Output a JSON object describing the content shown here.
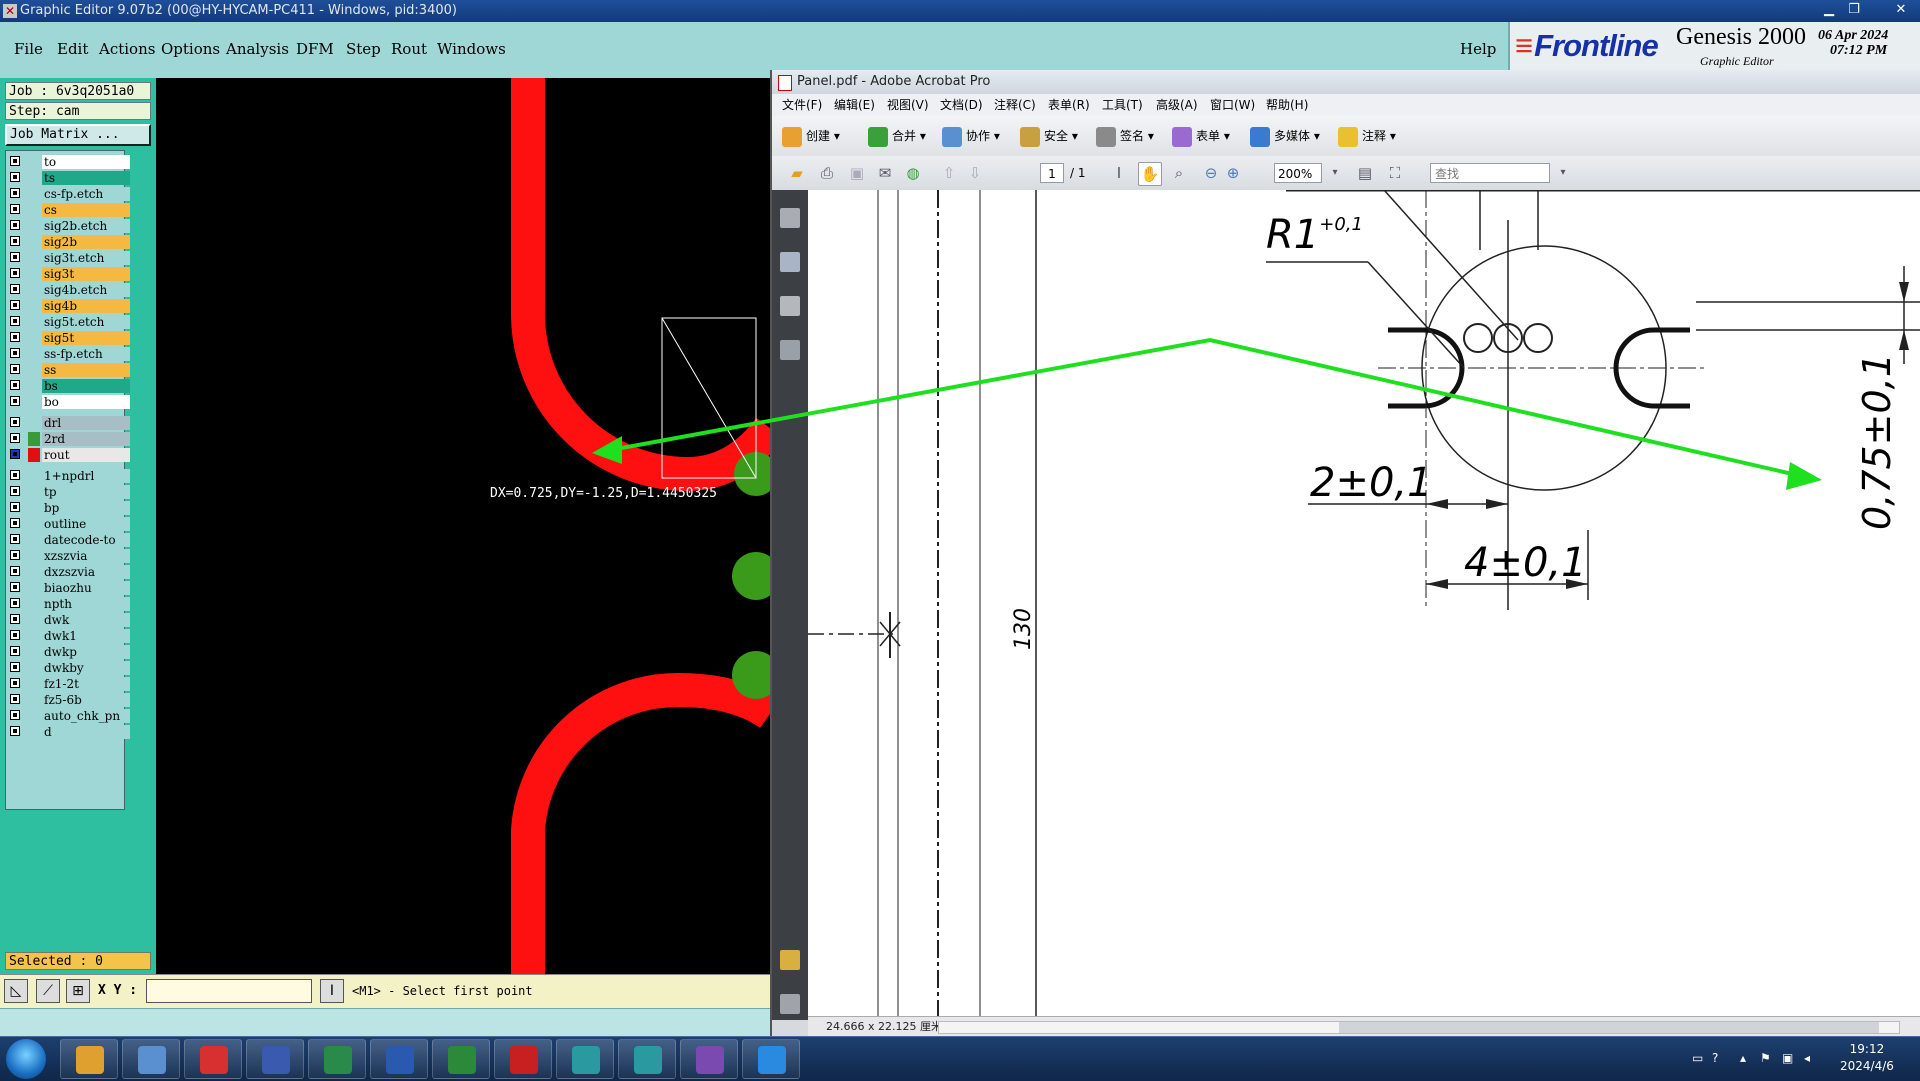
{
  "editor": {
    "title": "Graphic Editor 9.07b2 (00@HY-HYCAM-PC411 - Windows, pid:3400)",
    "menu": [
      "File",
      "Edit",
      "Actions",
      "Options",
      "Analysis",
      "DFM",
      "Step",
      "Rout",
      "Windows"
    ],
    "help": "Help",
    "brand": {
      "logo": "Frontline",
      "product": "Genesis 2000",
      "subtitle": "Graphic Editor",
      "date": "06 Apr 2024",
      "time": "07:12 PM"
    },
    "job": "Job : 6v3q2051a0",
    "step": "Step: cam",
    "job_matrix": "Job Matrix ...",
    "layers": [
      {
        "name": "to",
        "color": "#ffffff"
      },
      {
        "name": "ts",
        "color": "#1fa98a"
      },
      {
        "name": "cs-fp.etch",
        "color": "#9fd6d6"
      },
      {
        "name": "cs",
        "color": "#f4b942"
      },
      {
        "name": "sig2b.etch",
        "color": "#9fd6d6"
      },
      {
        "name": "sig2b",
        "color": "#f4b942"
      },
      {
        "name": "sig3t.etch",
        "color": "#9fd6d6"
      },
      {
        "name": "sig3t",
        "color": "#f4b942"
      },
      {
        "name": "sig4b.etch",
        "color": "#9fd6d6"
      },
      {
        "name": "sig4b",
        "color": "#f4b942"
      },
      {
        "name": "sig5t.etch",
        "color": "#9fd6d6"
      },
      {
        "name": "sig5t",
        "color": "#f4b942"
      },
      {
        "name": "ss-fp.etch",
        "color": "#9fd6d6"
      },
      {
        "name": "ss",
        "color": "#f4b942"
      },
      {
        "name": "bs",
        "color": "#1fa98a"
      },
      {
        "name": "bo",
        "color": "#ffffff"
      },
      {
        "name": "drl",
        "color": "#a7bfc4"
      },
      {
        "name": "2rd",
        "color": "#a7bfc4",
        "swatch": "#3a9a3a"
      },
      {
        "name": "rout",
        "color": "#e8e8e8",
        "swatch": "#e01010",
        "selected": true
      },
      {
        "name": "1+npdrl",
        "color": "#9fd6d6"
      },
      {
        "name": "tp",
        "color": "#9fd6d6"
      },
      {
        "name": "bp",
        "color": "#9fd6d6"
      },
      {
        "name": "outline",
        "color": "#9fd6d6"
      },
      {
        "name": "datecode-to",
        "color": "#9fd6d6"
      },
      {
        "name": "xzszvia",
        "color": "#9fd6d6"
      },
      {
        "name": "dxzszvia",
        "color": "#9fd6d6"
      },
      {
        "name": "biaozhu",
        "color": "#9fd6d6"
      },
      {
        "name": "npth",
        "color": "#9fd6d6"
      },
      {
        "name": "dwk",
        "color": "#9fd6d6"
      },
      {
        "name": "dwk1",
        "color": "#9fd6d6"
      },
      {
        "name": "dwkp",
        "color": "#9fd6d6"
      },
      {
        "name": "dwkby",
        "color": "#9fd6d6"
      },
      {
        "name": "fz1-2t",
        "color": "#9fd6d6"
      },
      {
        "name": "fz5-6b",
        "color": "#9fd6d6"
      },
      {
        "name": "auto_chk_pn",
        "color": "#9fd6d6"
      },
      {
        "name": "d",
        "color": "#9fd6d6"
      }
    ],
    "selected": "Selected : 0",
    "measure": "DX=0.725,DY=-1.25,D=1.4450325",
    "xy_label": "X Y :",
    "prompt": "<M1> - Select first point",
    "colors": {
      "trace": "#ff1010",
      "pad": "#3a9a1a",
      "accent": "#9fd6d6"
    }
  },
  "acrobat": {
    "title": "Panel.pdf - Adobe Acrobat Pro",
    "menu": [
      "文件(F)",
      "编辑(E)",
      "视图(V)",
      "文档(D)",
      "注释(C)",
      "表单(R)",
      "工具(T)",
      "高级(A)",
      "窗口(W)",
      "帮助(H)"
    ],
    "toolbar": [
      "创建",
      "合并",
      "协作",
      "安全",
      "签名",
      "表单",
      "多媒体",
      "注释"
    ],
    "page_current": "1",
    "page_total": "/ 1",
    "zoom": "200%",
    "find_placeholder": "查找",
    "page_size": "24.666 x 22.125 厘米",
    "drawing": {
      "radius": "R1",
      "radius_tol": "+0,1",
      "dim_130": "130",
      "dim_2": "2±0,1",
      "dim_4": "4±0,1",
      "dim_075": "0,75±0,1"
    }
  },
  "taskbar": {
    "time": "19:12",
    "date": "2024/4/6"
  }
}
